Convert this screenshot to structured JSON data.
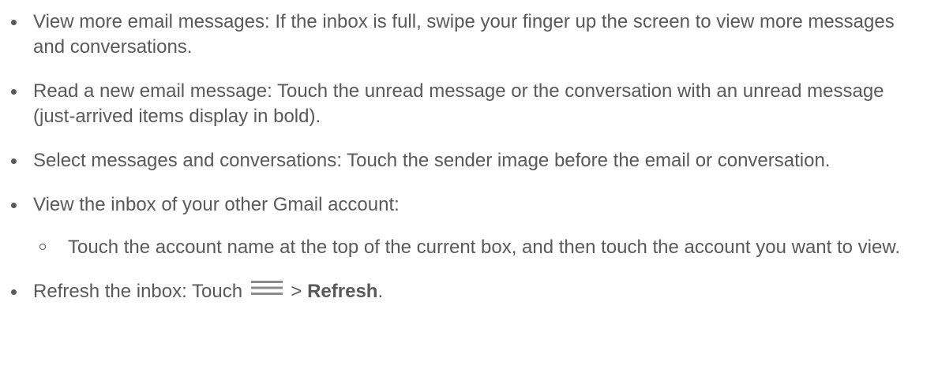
{
  "items": [
    {
      "text": "View more email messages: If the inbox is full, swipe your finger up the screen to view more messages and conversations."
    },
    {
      "text": "Read a new email message: Touch the unread message or the conversation with an unread message (just-arrived items display in bold)."
    },
    {
      "text": "Select messages and conversations: Touch the sender image before the email or conversation."
    },
    {
      "text": "View the inbox of your other Gmail account:",
      "subitems": [
        {
          "text": "Touch the account name at the top of the current box, and then touch the account you want to view."
        }
      ]
    },
    {
      "prefix": "Refresh the inbox: Touch",
      "icon": "menu-icon",
      "separator": ">",
      "bold": "Refresh",
      "suffix": "."
    }
  ],
  "colors": {
    "text": "#595959",
    "background": "#ffffff"
  }
}
